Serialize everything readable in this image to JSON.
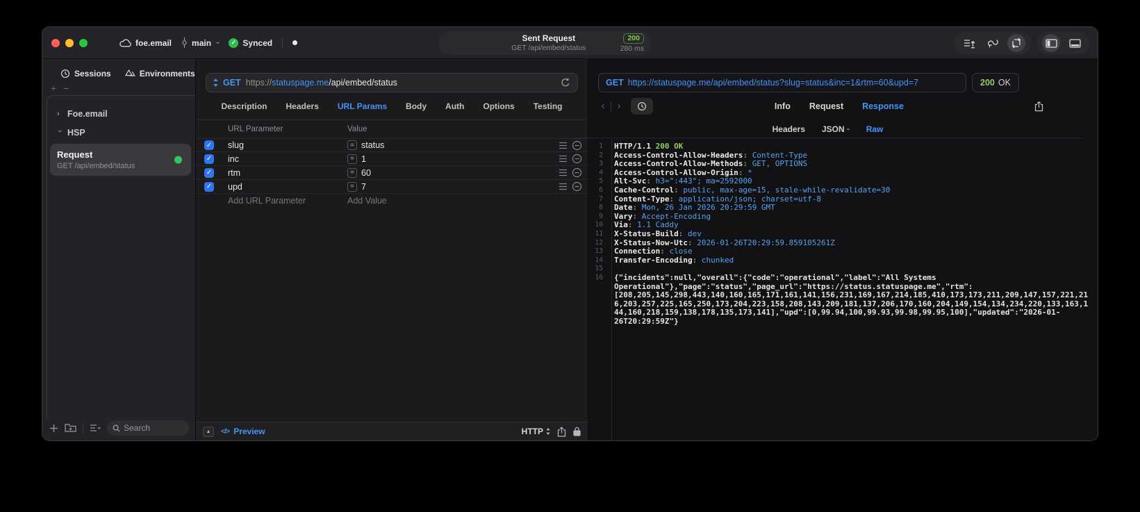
{
  "colors": {
    "accent_blue": "#4493f8",
    "sync_green": "#2ebd4f",
    "status_green": "#8fce5f",
    "badge_green": "#74d354",
    "checkbox_blue": "#3174f1",
    "traffic_red": "#ff5f57",
    "traffic_yellow": "#febc2e",
    "traffic_green": "#28c840"
  },
  "titlebar": {
    "project": "foe.email",
    "branch": "main",
    "sync": "Synced",
    "request_title": "Sent Request",
    "request_subtitle": "GET /api/embed/status",
    "status_code": "200",
    "duration": "280 ms"
  },
  "sidebar": {
    "tabs": [
      {
        "label": "Sessions",
        "icon": "history-clock-icon"
      },
      {
        "label": "Environments",
        "icon": "environments-icon"
      }
    ],
    "add_label": "+",
    "remove_label": "−",
    "tree": [
      {
        "label": "Foe.email",
        "expanded": false
      },
      {
        "label": "HSP",
        "expanded": true
      }
    ],
    "request_item": {
      "title": "Request",
      "subtitle": "GET /api/embed/status"
    },
    "search_placeholder": "Search"
  },
  "editor": {
    "method": "GET",
    "url_scheme": "https://",
    "url_host": "statuspage.me",
    "url_path": "/api/embed/status",
    "tabs": [
      "Description",
      "Headers",
      "URL Params",
      "Body",
      "Auth",
      "Options",
      "Testing"
    ],
    "active_tab": "URL Params",
    "table": {
      "col_name": "URL Parameter",
      "col_value": "Value",
      "rows": [
        {
          "name": "slug",
          "value": "status",
          "enabled": true
        },
        {
          "name": "inc",
          "value": "1",
          "enabled": true
        },
        {
          "name": "rtm",
          "value": "60",
          "enabled": true
        },
        {
          "name": "upd",
          "value": "7",
          "enabled": true
        }
      ],
      "add_name": "Add URL Parameter",
      "add_value": "Add Value"
    },
    "footer": {
      "preview": "Preview",
      "protocol": "HTTP"
    }
  },
  "response": {
    "method": "GET",
    "url": "https://statuspage.me/api/embed/status?slug=status&inc=1&rtm=60&upd=7",
    "status_code": "200",
    "status_text": "OK",
    "tabs": [
      "Info",
      "Request",
      "Response"
    ],
    "active_tab": "Response",
    "subtabs": [
      {
        "label": "Headers"
      },
      {
        "label": "JSON",
        "chevron": true
      },
      {
        "label": "Raw"
      }
    ],
    "active_subtab": "Raw",
    "lines": [
      {
        "n": "1",
        "segs": [
          {
            "t": "HTTP/1.1 ",
            "c": "k"
          },
          {
            "t": "200 OK",
            "c": "g"
          }
        ]
      },
      {
        "n": "2",
        "segs": [
          {
            "t": "Access-Control-Allow-Headers",
            "c": "k"
          },
          {
            "t": ": ",
            "c": "d"
          },
          {
            "t": "Content-Type",
            "c": "b"
          }
        ]
      },
      {
        "n": "3",
        "segs": [
          {
            "t": "Access-Control-Allow-Methods",
            "c": "k"
          },
          {
            "t": ": ",
            "c": "d"
          },
          {
            "t": "GET, OPTIONS",
            "c": "b"
          }
        ]
      },
      {
        "n": "4",
        "segs": [
          {
            "t": "Access-Control-Allow-Origin",
            "c": "k"
          },
          {
            "t": ": ",
            "c": "d"
          },
          {
            "t": "*",
            "c": "b"
          }
        ]
      },
      {
        "n": "5",
        "segs": [
          {
            "t": "Alt-Svc",
            "c": "k"
          },
          {
            "t": ": ",
            "c": "d"
          },
          {
            "t": "h3=\":443\"; ma=2592000",
            "c": "b"
          }
        ]
      },
      {
        "n": "6",
        "segs": [
          {
            "t": "Cache-Control",
            "c": "k"
          },
          {
            "t": ": ",
            "c": "d"
          },
          {
            "t": "public, max-age=15, stale-while-revalidate=30",
            "c": "b"
          }
        ]
      },
      {
        "n": "7",
        "segs": [
          {
            "t": "Content-Type",
            "c": "k"
          },
          {
            "t": ": ",
            "c": "d"
          },
          {
            "t": "application/json; charset=utf-8",
            "c": "b"
          }
        ]
      },
      {
        "n": "8",
        "segs": [
          {
            "t": "Date",
            "c": "k"
          },
          {
            "t": ": ",
            "c": "d"
          },
          {
            "t": "Mon, 26 Jan 2026 20:29:59 GMT",
            "c": "b"
          }
        ]
      },
      {
        "n": "9",
        "segs": [
          {
            "t": "Vary",
            "c": "k"
          },
          {
            "t": ": ",
            "c": "d"
          },
          {
            "t": "Accept-Encoding",
            "c": "b"
          }
        ]
      },
      {
        "n": "10",
        "segs": [
          {
            "t": "Via",
            "c": "k"
          },
          {
            "t": ": ",
            "c": "d"
          },
          {
            "t": "1.1 Caddy",
            "c": "b"
          }
        ]
      },
      {
        "n": "11",
        "segs": [
          {
            "t": "X-Status-Build",
            "c": "k"
          },
          {
            "t": ": ",
            "c": "d"
          },
          {
            "t": "dev",
            "c": "b"
          }
        ]
      },
      {
        "n": "12",
        "segs": [
          {
            "t": "X-Status-Now-Utc",
            "c": "k"
          },
          {
            "t": ": ",
            "c": "d"
          },
          {
            "t": "2026-01-26T20:29:59.859105261Z",
            "c": "b"
          }
        ]
      },
      {
        "n": "13",
        "segs": [
          {
            "t": "Connection",
            "c": "k"
          },
          {
            "t": ": ",
            "c": "d"
          },
          {
            "t": "close",
            "c": "b"
          }
        ]
      },
      {
        "n": "14",
        "segs": [
          {
            "t": "Transfer-Encoding",
            "c": "k"
          },
          {
            "t": ": ",
            "c": "d"
          },
          {
            "t": "chunked",
            "c": "b"
          }
        ]
      },
      {
        "n": "15",
        "segs": []
      },
      {
        "n": "16",
        "segs": [
          {
            "t": "{\"incidents\":null,\"overall\":{\"code\":\"operational\",\"label\":\"All Systems Operational\"},\"page\":\"status\",\"page_url\":\"https://status.statuspage.me\",\"rtm\":[208,205,145,298,443,140,160,165,171,161,141,156,231,169,167,214,185,410,173,173,211,209,147,157,221,216,203,257,225,165,250,173,204,223,158,208,143,209,181,137,206,170,160,204,149,154,134,234,220,133,163,144,160,218,159,138,178,135,173,141],\"upd\":[0,99.94,100,99.93,99.98,99.95,100],\"updated\":\"2026-01-26T20:29:59Z\"}",
            "c": "w"
          }
        ]
      }
    ]
  }
}
